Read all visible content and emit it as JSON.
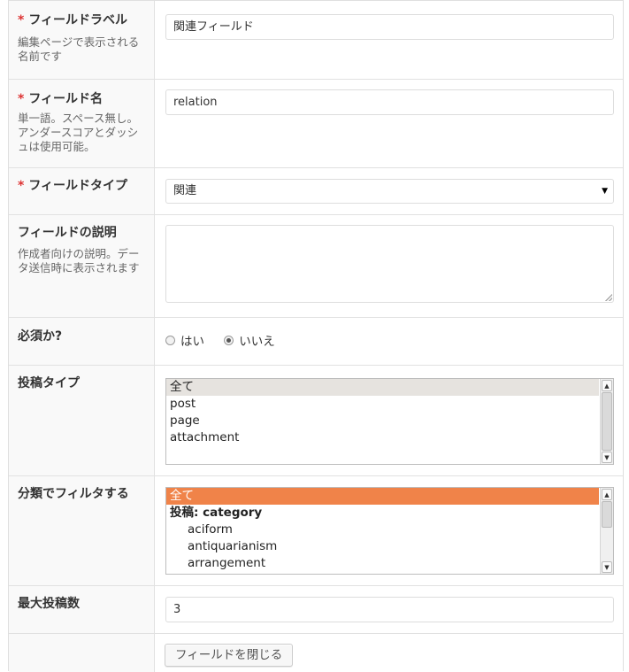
{
  "required_mark": "*",
  "field_label": {
    "label": "フィールドラベル",
    "description": "編集ページで表示される名前です",
    "value": "関連フィールド"
  },
  "field_name": {
    "label": "フィールド名",
    "description": "単一語。スペース無し。アンダースコアとダッシュは使用可能。",
    "value": "relation"
  },
  "field_type": {
    "label": "フィールドタイプ",
    "selected": "関連",
    "arrow": "▼"
  },
  "field_instructions": {
    "label": "フィールドの説明",
    "description": "作成者向けの説明。データ送信時に表示されます",
    "value": ""
  },
  "required": {
    "label": "必須か?",
    "options": [
      {
        "label": "はい",
        "checked": false
      },
      {
        "label": "いいえ",
        "checked": true
      }
    ]
  },
  "post_type": {
    "label": "投稿タイプ",
    "options": [
      "全て",
      "post",
      "page",
      "attachment"
    ]
  },
  "taxonomy_filter": {
    "label": "分類でフィルタする",
    "options": [
      {
        "text": "全て",
        "style": "selected"
      },
      {
        "text": "投稿: category",
        "style": "group"
      },
      {
        "text": "aciform",
        "style": "indent"
      },
      {
        "text": "antiquarianism",
        "style": "indent"
      },
      {
        "text": "arrangement",
        "style": "indent"
      }
    ]
  },
  "max_posts": {
    "label": "最大投稿数",
    "value": "3"
  },
  "close_button": "フィールドを閉じる",
  "colors": {
    "required": "#dd3333",
    "selected_option": "#f08349",
    "label_cell_bg": "#f9f9f9"
  }
}
